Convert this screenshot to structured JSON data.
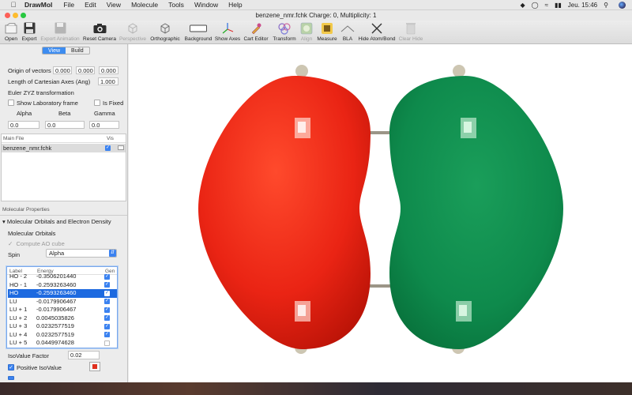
{
  "menubar": {
    "app_name": "DrawMol",
    "items": [
      "File",
      "Edit",
      "View",
      "Molecule",
      "Tools",
      "Window",
      "Help"
    ],
    "clock": "Jeu. 15:46"
  },
  "window": {
    "title": "benzene_nmr.fchk  Charge:  0, Multiplicity:  1"
  },
  "toolbar": {
    "open": "Open",
    "export": "Export",
    "export_animation": "Export Animation",
    "reset_camera": "Reset Camera",
    "perspective": "Perspective",
    "orthographic": "Orthographic",
    "background": "Background",
    "show_axes": "Show Axes",
    "cart_editor": "Cart Editor",
    "transform": "Transform",
    "align": "Align",
    "measure": "Measure",
    "bla": "BLA",
    "hide_atom_bond": "Hide Atom/Bond",
    "clear_hide": "Clear Hide"
  },
  "view_panel": {
    "tab_view": "View",
    "tab_build": "Build",
    "origin_label": "Origin of vectors",
    "origin_x": "0.000",
    "origin_y": "0.000",
    "origin_z": "0.000",
    "axes_length_label": "Length of Cartesian Axes (Ang)",
    "axes_length": "1.000",
    "euler_label": "Euler ZYZ transformation",
    "show_lab_frame": "Show Laboratory frame",
    "is_fixed": "Is Fixed",
    "alpha_label": "Alpha",
    "beta_label": "Beta",
    "gamma_label": "Gamma",
    "alpha": "0.0",
    "beta": "0.0",
    "gamma": "0.0"
  },
  "files": {
    "col_main": "Main File",
    "col_vis": "Vis",
    "rows": [
      {
        "name": "benzene_nmr.fchk"
      }
    ]
  },
  "properties": {
    "header": "Molecular Properties",
    "section": "Molecular Orbitals and Electron Density",
    "mo_label": "Molecular Orbitals",
    "compute_ao": "Compute AO cube",
    "spin_label": "Spin",
    "spin_value": "Alpha",
    "col_label": "Label",
    "col_energy": "Energy",
    "col_gen": "Gen",
    "orbitals": [
      {
        "label": "HO - 2",
        "energy": "-0.3506201440"
      },
      {
        "label": "HO - 1",
        "energy": "-0.2593263460"
      },
      {
        "label": "HO",
        "energy": "-0.2593263460"
      },
      {
        "label": "LU",
        "energy": "-0.0179906467"
      },
      {
        "label": "LU + 1",
        "energy": "-0.0179906467"
      },
      {
        "label": "LU + 2",
        "energy": "0.0045035826"
      },
      {
        "label": "LU + 3",
        "energy": "0.0232577519"
      },
      {
        "label": "LU + 4",
        "energy": "0.0232577519"
      },
      {
        "label": "LU + 5",
        "energy": "0.0449974628"
      }
    ],
    "isovalue_label": "IsoValue Factor",
    "isovalue": "0.02",
    "positive_isovalue": "Positive IsoValue",
    "positive_color": "#e0301e"
  },
  "colors": {
    "accent": "#3b82f0",
    "lobe_positive": "#e8261a",
    "lobe_negative": "#0e8a4c"
  }
}
